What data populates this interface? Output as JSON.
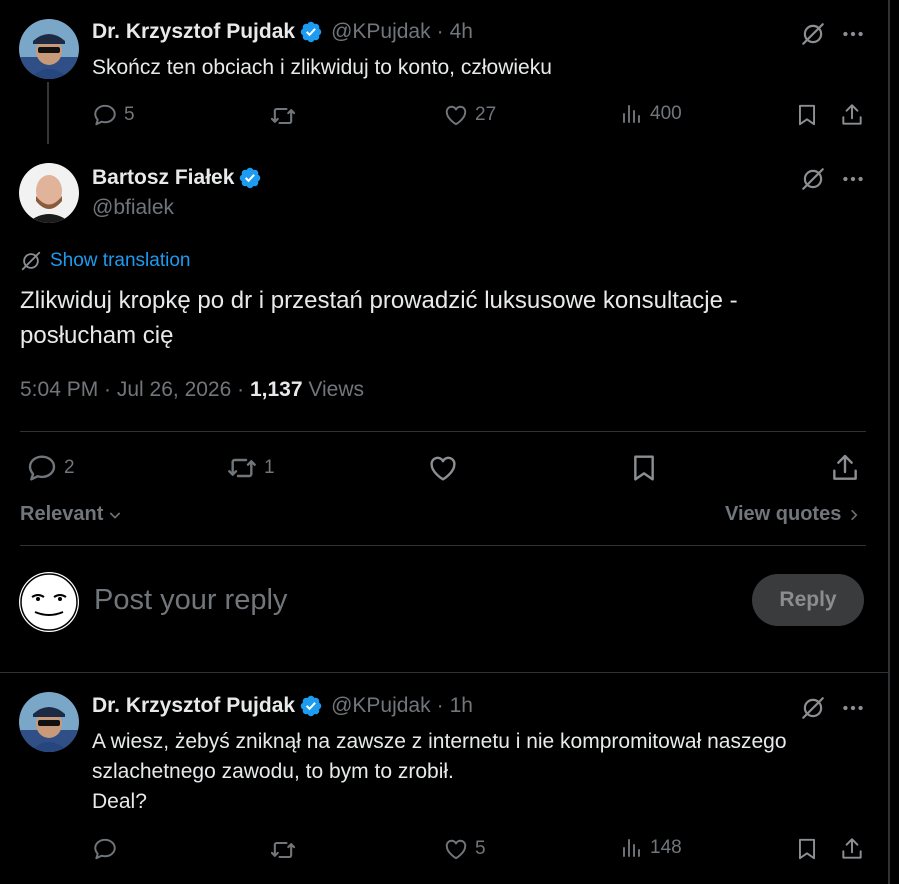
{
  "parent_tweet": {
    "author_name": "Dr. Krzysztof Pujdak",
    "handle": "@KPujdak",
    "time": "4h",
    "text": "Skończ ten obciach i zlikwiduj to konto, człowieku",
    "replies": "5",
    "likes": "27",
    "views": "400"
  },
  "main_tweet": {
    "author_name": "Bartosz Fiałek",
    "handle": "@bfialek",
    "show_translation": "Show translation",
    "text": "Zlikwiduj kropkę po dr i przestań prowadzić luksusowe konsultacje -\nposłucham cię",
    "timestamp": "5:04 PM · Jul 26, 2026 · ",
    "views_count": "1,137",
    "views_label": " Views",
    "replies": "2",
    "reposts": "1"
  },
  "sort": {
    "label": "Relevant",
    "view_quotes": "View quotes"
  },
  "composer": {
    "placeholder": "Post your reply",
    "reply_label": "Reply"
  },
  "reply_tweet": {
    "author_name": "Dr. Krzysztof Pujdak",
    "handle": "@KPujdak",
    "time": "1h",
    "text": "A wiesz, żebyś zniknął na zawsze z internetu i nie kompromitował naszego\nszlachetnego zawodu, to bym to zrobił.\nDeal?",
    "likes": "5",
    "views": "148"
  },
  "colors": {
    "background": "#000000",
    "text": "#e7e9ea",
    "muted": "#71767b",
    "accent": "#1d9bf0",
    "divider": "#2f3336"
  }
}
